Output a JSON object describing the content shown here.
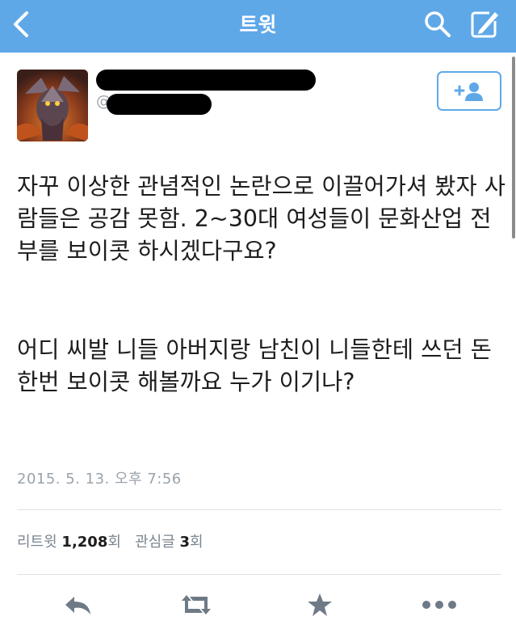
{
  "header": {
    "title": "트윗",
    "background_color": "#5fa8e8",
    "icons": [
      "back-chevron-icon",
      "search-icon",
      "compose-icon"
    ]
  },
  "tweet": {
    "text_paragraph_1": "자꾸 이상한 관념적인 논란으로 이끌어가셔 봤자 사람들은 공감 못함. 2~30대 여성들이 문화산업 전부를 보이콧 하시겠다구요?",
    "text_paragraph_2": "어디 씨발 니들 아버지랑 남친이 니들한테 쓰던 돈 한번 보이콧 해볼까요 누가 이기나?",
    "at_symbol": "@",
    "timestamp": "2015. 5. 13. 오후 7:56"
  },
  "stats": {
    "retweet_label": "리트윗",
    "retweet_count": "1,208",
    "retweet_unit": "회",
    "favorite_label": "관심글",
    "favorite_count": "3",
    "favorite_unit": "회"
  },
  "actions": [
    "reply-icon",
    "retweet-icon",
    "favorite-icon",
    "more-icon"
  ],
  "accent_color": "#5fa8e8"
}
